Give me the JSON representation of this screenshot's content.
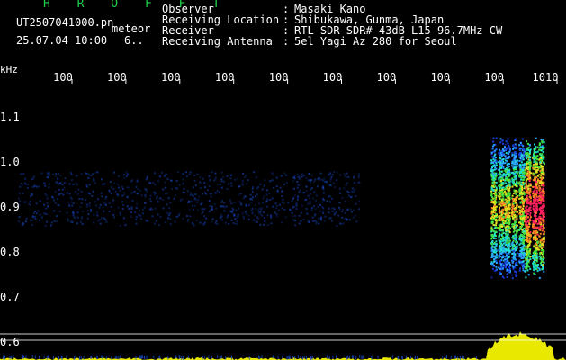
{
  "header": {
    "brand": "H R O F F T",
    "filename": "UT2507041000.pn",
    "kind": "meteor",
    "datetime": "25.07.04 10:00",
    "value": "6..",
    "fields": [
      {
        "label": "Observer",
        "value": "Masaki Kano"
      },
      {
        "label": "Receiving Location",
        "value": "Shibukawa, Gunma, Japan"
      },
      {
        "label": "Receiver",
        "value": "RTL-SDR SDR# 43dB L15 96.7MHz CW"
      },
      {
        "label": "Receiving Antenna",
        "value": "5el Yagi Az 280 for Seoul"
      }
    ],
    "separator": ":"
  },
  "chart_data": {
    "type": "heatmap",
    "ylabel": "kHz",
    "y_ticks": [
      "1.1",
      "1.0",
      "0.9",
      "0.8",
      "0.7",
      "0.6"
    ],
    "x_ticks": [
      "100",
      "100",
      "100",
      "100",
      "100",
      "100",
      "100",
      "100",
      "100",
      "1010"
    ],
    "ylim": [
      0.58,
      1.15
    ],
    "grid": false,
    "colors": {
      "background": "#000000",
      "baseline": "#ffffff",
      "tick": "#ffffff",
      "activity": "#e8e800",
      "noise": "#1848c8"
    },
    "echo": {
      "frequency_range_khz": [
        0.78,
        0.98
      ]
    }
  }
}
